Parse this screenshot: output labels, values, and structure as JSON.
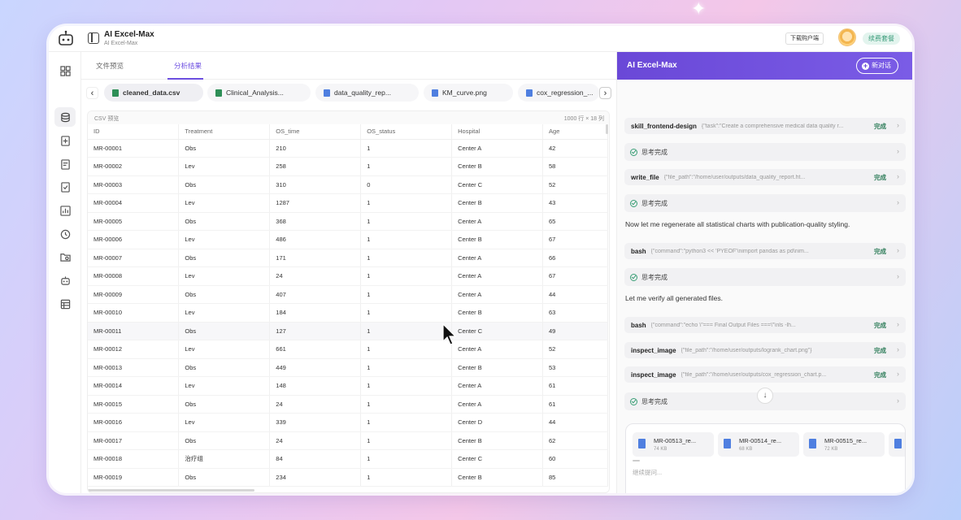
{
  "header": {
    "title": "AI Excel-Max",
    "subtitle": "AI Excel-Max",
    "download_label": "下载购户端",
    "renew_label": "续费套餐"
  },
  "left": {
    "tabs": [
      {
        "label": "文件预览"
      },
      {
        "label": "分析结果"
      }
    ],
    "files": [
      {
        "name": "cleaned_data.csv"
      },
      {
        "name": "Clinical_Analysis..."
      },
      {
        "name": "data_quality_rep..."
      },
      {
        "name": "KM_curve.png"
      },
      {
        "name": "cox_regression_..."
      }
    ],
    "table": {
      "caption": "CSV 预览",
      "dims": "1000 行 × 18 列",
      "columns": [
        "ID",
        "Treatment",
        "OS_time",
        "OS_status",
        "Hospital",
        "Age"
      ],
      "rows": [
        [
          "MR-00001",
          "Obs",
          "210",
          "1",
          "Center A",
          "42"
        ],
        [
          "MR-00002",
          "Lev",
          "258",
          "1",
          "Center B",
          "58"
        ],
        [
          "MR-00003",
          "Obs",
          "310",
          "0",
          "Center C",
          "52"
        ],
        [
          "MR-00004",
          "Lev",
          "1287",
          "1",
          "Center B",
          "43"
        ],
        [
          "MR-00005",
          "Obs",
          "368",
          "1",
          "Center A",
          "65"
        ],
        [
          "MR-00006",
          "Lev",
          "486",
          "1",
          "Center B",
          "67"
        ],
        [
          "MR-00007",
          "Obs",
          "171",
          "1",
          "Center A",
          "66"
        ],
        [
          "MR-00008",
          "Lev",
          "24",
          "1",
          "Center A",
          "67"
        ],
        [
          "MR-00009",
          "Obs",
          "407",
          "1",
          "Center A",
          "44"
        ],
        [
          "MR-00010",
          "Lev",
          "184",
          "1",
          "Center B",
          "63"
        ],
        [
          "MR-00011",
          "Obs",
          "127",
          "1",
          "Center C",
          "49"
        ],
        [
          "MR-00012",
          "Lev",
          "661",
          "1",
          "Center A",
          "52"
        ],
        [
          "MR-00013",
          "Obs",
          "449",
          "1",
          "Center B",
          "53"
        ],
        [
          "MR-00014",
          "Lev",
          "148",
          "1",
          "Center A",
          "61"
        ],
        [
          "MR-00015",
          "Obs",
          "24",
          "1",
          "Center A",
          "61"
        ],
        [
          "MR-00016",
          "Lev",
          "339",
          "1",
          "Center D",
          "44"
        ],
        [
          "MR-00017",
          "Obs",
          "24",
          "1",
          "Center B",
          "62"
        ],
        [
          "MR-00018",
          "治疗组",
          "84",
          "1",
          "Center C",
          "60"
        ],
        [
          "MR-00019",
          "Obs",
          "234",
          "1",
          "Center B",
          "85"
        ]
      ]
    }
  },
  "chat": {
    "title": "AI Excel-Max",
    "new_chat_label": "新对话",
    "items": [
      {
        "kind": "tool",
        "name": "skill_frontend-design",
        "args": "{\"task\":\"Create a comprehensive medical data quality r...",
        "status": "完成"
      },
      {
        "kind": "think",
        "label": "思考完成"
      },
      {
        "kind": "tool",
        "name": "write_file",
        "args": "{\"file_path\":\"/home/user/outputs/data_quality_report.ht...",
        "status": "完成"
      },
      {
        "kind": "think",
        "label": "思考完成"
      },
      {
        "kind": "msg",
        "text": "Now let me regenerate all statistical charts with publication-quality styling."
      },
      {
        "kind": "tool",
        "name": "bash",
        "args": "{\"command\":\"python3 << 'PYEOF'\\nimport pandas as pd\\nim...",
        "status": "完成"
      },
      {
        "kind": "think",
        "label": "思考完成"
      },
      {
        "kind": "msg",
        "text": "Let me verify all generated files."
      },
      {
        "kind": "tool",
        "name": "bash",
        "args": "{\"command\":\"echo \\\"=== Final Output Files ===\\\"\\nls -lh...",
        "status": "完成"
      },
      {
        "kind": "tool",
        "name": "inspect_image",
        "args": "{\"file_path\":\"/home/user/outputs/logrank_chart.png\"}",
        "status": "完成"
      },
      {
        "kind": "tool",
        "name": "inspect_image",
        "args": "{\"file_path\":\"/home/user/outputs/cox_regression_chart.p...",
        "status": "完成"
      },
      {
        "kind": "think",
        "label": "思考完成"
      }
    ],
    "attachments": [
      {
        "name": "MR-00513_re...",
        "size": "74 KB"
      },
      {
        "name": "MR-00514_re...",
        "size": "68 KB"
      },
      {
        "name": "MR-00515_re...",
        "size": "72 KB"
      }
    ],
    "input_placeholder": "继续提问..."
  },
  "colors": {
    "accent": "#6c4ee0",
    "success": "#2f7d5a"
  }
}
